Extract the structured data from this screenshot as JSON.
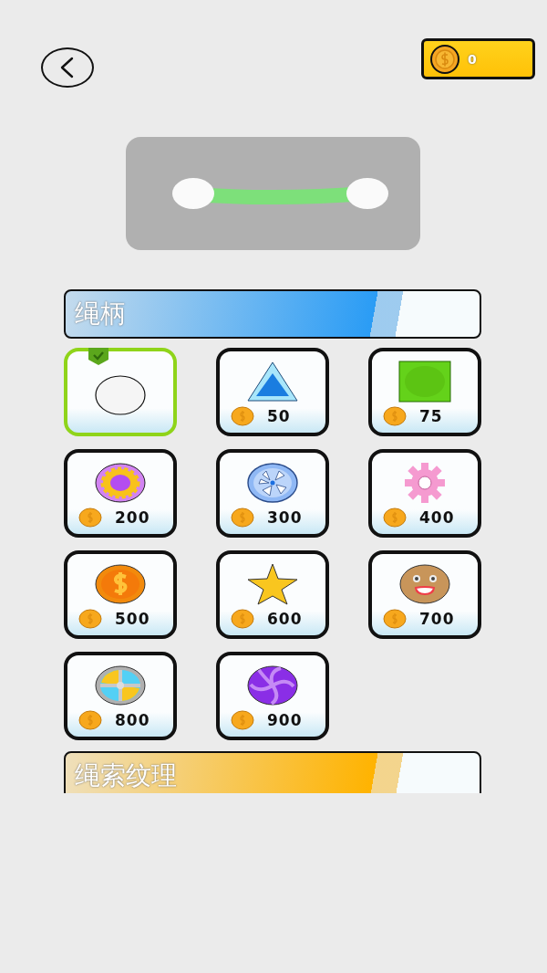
{
  "coins": {
    "value": "0"
  },
  "preview": {
    "kind": "rope"
  },
  "sections": [
    {
      "title": "绳柄",
      "color": "#2a9cf5",
      "items": [
        {
          "kind": "circle",
          "selected": true
        },
        {
          "kind": "triangle",
          "selected": false,
          "price": "50"
        },
        {
          "kind": "square",
          "selected": false,
          "price": "75"
        },
        {
          "kind": "gear-disc",
          "selected": false,
          "price": "200"
        },
        {
          "kind": "wheel",
          "selected": false,
          "price": "300"
        },
        {
          "kind": "cog",
          "selected": false,
          "price": "400"
        },
        {
          "kind": "coin",
          "selected": false,
          "price": "500"
        },
        {
          "kind": "star",
          "selected": false,
          "price": "600"
        },
        {
          "kind": "face",
          "selected": false,
          "price": "700"
        },
        {
          "kind": "fan",
          "selected": false,
          "price": "800"
        },
        {
          "kind": "swirl",
          "selected": false,
          "price": "900"
        }
      ]
    },
    {
      "title": "绳索纹理",
      "color": "#ffb300"
    }
  ]
}
